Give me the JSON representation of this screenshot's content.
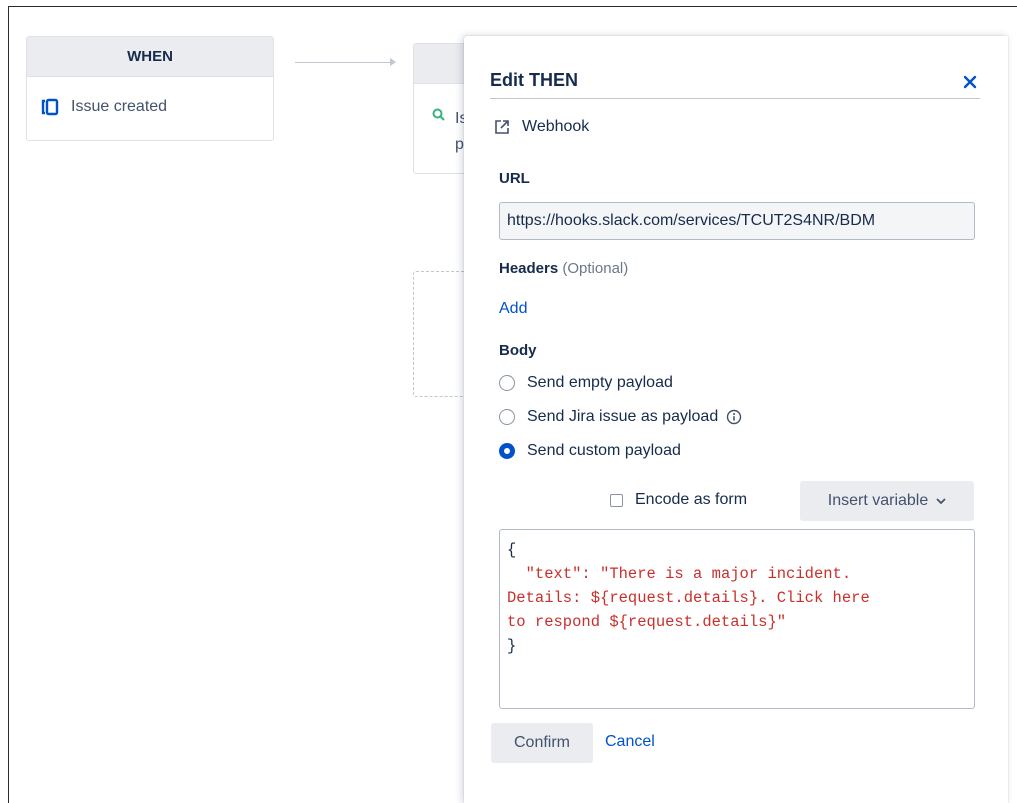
{
  "canvas": {
    "trigger_card": {
      "header": "WHEN",
      "item_label": "Issue created",
      "item_icon": "issue-created-icon"
    },
    "condition_card": {
      "item_icon": "search-icon",
      "text_line1": "Is",
      "text_line2": "p"
    }
  },
  "panel": {
    "title": "Edit THEN",
    "close_icon": "close-icon",
    "action_icon": "external-link-icon",
    "action_label": "Webhook",
    "url": {
      "label": "URL",
      "value": "https://hooks.slack.com/services/TCUT2S4NR/BDM"
    },
    "headers": {
      "label": "Headers",
      "optional": "(Optional)",
      "add_link": "Add"
    },
    "body": {
      "label": "Body",
      "options": [
        {
          "label": "Send empty payload",
          "selected": false
        },
        {
          "label": "Send Jira issue as payload",
          "selected": false,
          "has_info": true
        },
        {
          "label": "Send custom payload",
          "selected": true
        }
      ]
    },
    "encode_as_form": {
      "label": "Encode as form",
      "checked": false
    },
    "insert_variable": {
      "label": "Insert variable"
    },
    "custom_payload": {
      "open_brace": "{",
      "line1": "  \"text\": \"There is a major incident.",
      "line2": "Details: ${request.details}. Click here",
      "line3": "to respond ${request.details}\"",
      "close_brace": "}"
    },
    "confirm_label": "Confirm",
    "cancel_label": "Cancel"
  },
  "colors": {
    "accent": "#0052cc",
    "code_string": "#c9302c",
    "header_bg": "#ebecf0"
  }
}
